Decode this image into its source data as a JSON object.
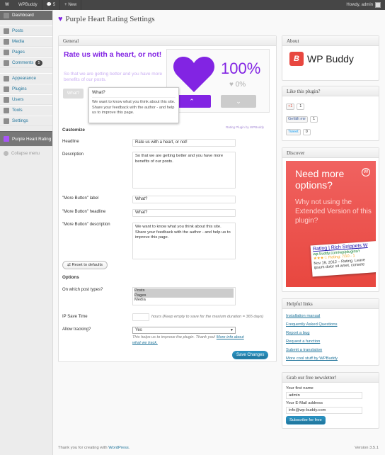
{
  "adminbar": {
    "wp": "W",
    "site": "WPBuddy",
    "comments": "5",
    "new": "+ New",
    "howdy": "Howdy, admin"
  },
  "menu": [
    {
      "label": "Dashboard",
      "icon": "dashboard-icon"
    },
    {
      "label": "Posts",
      "icon": "posts-icon"
    },
    {
      "label": "Media",
      "icon": "media-icon"
    },
    {
      "label": "Pages",
      "icon": "pages-icon"
    },
    {
      "label": "Comments",
      "icon": "comments-icon",
      "badge": "5"
    },
    {
      "label": "Appearance",
      "icon": "appearance-icon"
    },
    {
      "label": "Plugins",
      "icon": "plugins-icon"
    },
    {
      "label": "Users",
      "icon": "users-icon"
    },
    {
      "label": "Tools",
      "icon": "tools-icon"
    },
    {
      "label": "Settings",
      "icon": "settings-icon"
    },
    {
      "label": "Purple Heart Rating",
      "icon": "heart-icon"
    }
  ],
  "collapse": "Collapse menu",
  "page_title": "Purple Heart Rating Settings",
  "general": {
    "header": "General",
    "preview": {
      "headline": "Rate us with a heart, or not!",
      "description": "So that we are getting better and you have more benefits of our posts.",
      "more_button": "What?",
      "tooltip_title": "What?",
      "tooltip_text": "We want to know what you think about this site. Share your feedback with the author - and help us to improve this page.",
      "percent_big": "100%",
      "percent_small": "0%",
      "up": "⌃",
      "down": "⌄",
      "credit": "Rating Plugin by WPBuddy"
    },
    "customize": "Customize",
    "headline_label": "Headline",
    "headline_value": "Rate us with a heart, or not!",
    "description_label": "Description",
    "description_value": "So that we are getting better and you have more benefits of our posts.",
    "more_label_label": "\"More Button\" label",
    "more_label_value": "What?",
    "more_headline_label": "\"More Button\" headline",
    "more_headline_value": "What?",
    "more_desc_label": "\"More Button\" description",
    "more_desc_value": "We want to know what you think about this site. Share your feedback with the author - and help us to improve this page.",
    "reset": "Reset to defaults",
    "options": "Options",
    "post_types_label": "On which post types?",
    "post_types": [
      "Posts",
      "Pages",
      "Media"
    ],
    "ip_label": "IP Save Time",
    "ip_value": "",
    "ip_hint": "hours (Keep empty to save for the maxium duration = 365 days)",
    "tracking_label": "Allow tracking?",
    "tracking_value": "Yes",
    "tracking_hint": "This helps us to improve the plugin. Thank you!",
    "tracking_link": "More info about what we track.",
    "save": "Save Changes"
  },
  "about": {
    "header": "About",
    "logo_letter": "B",
    "logo_text": "WP Buddy"
  },
  "like": {
    "header": "Like this plugin?",
    "gplus": "+1",
    "gplus_count": "1",
    "fb": "Gefällt mir",
    "fb_count": "1",
    "tw": "Tweet",
    "tw_count": "0"
  },
  "discover": {
    "header": "Discover",
    "line1": "Need more options?",
    "line2": "Why not using the Extended Version of this plugin?",
    "card_title": "Rating | Rich Snippets W",
    "card_url": "wp-buddy.com/wp/plugins/r",
    "card_stars": "★★★☆ Rating: 7/10 - 1",
    "card_date": "Nov 19, 2012 – Rating. Leave",
    "card_text": "ipsum dolor sit amet, consete"
  },
  "helpful": {
    "header": "Helpful links",
    "links": [
      "Installation manual",
      "Frequently Asked Questions",
      "Report a bug",
      "Request a function",
      "Submit a translation",
      "More cool stuff by WPBuddy"
    ]
  },
  "newsletter": {
    "header": "Grab our free newsletter!",
    "name_label": "Your first name",
    "name_value": "admin",
    "email_label": "Your E-Mail address",
    "email_value": "info@wp-buddy.com",
    "button": "Subscribe for free"
  },
  "footer": {
    "text": "Thank you for creating with",
    "link": "WordPress",
    "version": "Version 3.5.1"
  }
}
